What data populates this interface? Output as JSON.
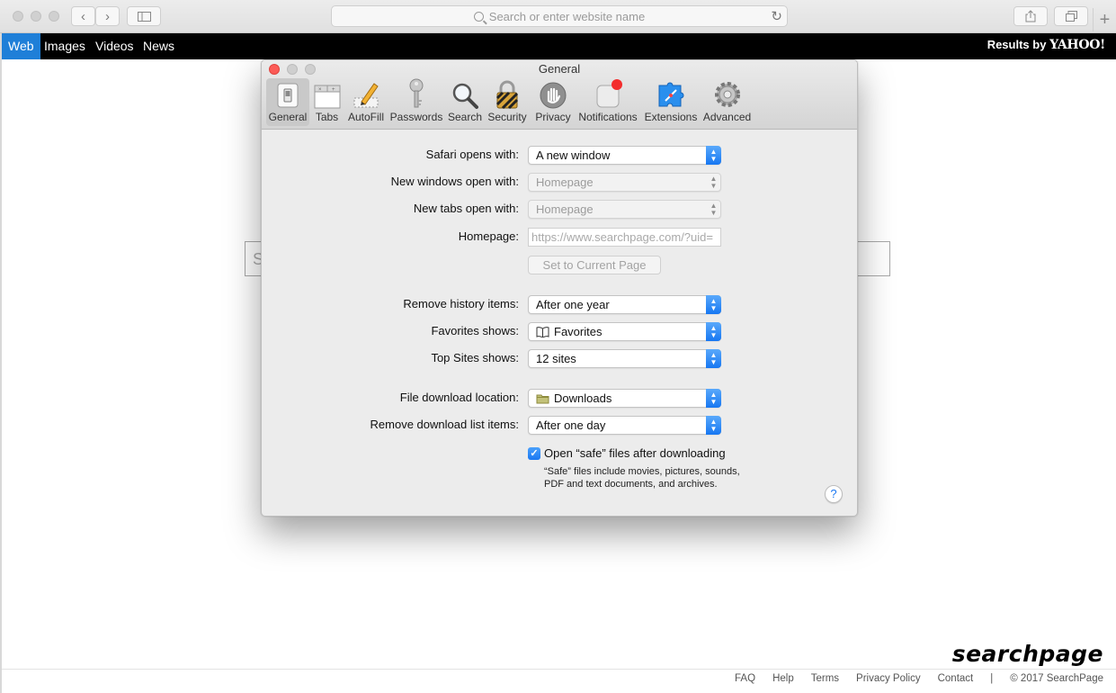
{
  "browser": {
    "address_placeholder": "Search or enter website name"
  },
  "navbar": {
    "items": [
      "Web",
      "Images",
      "Videos",
      "News"
    ],
    "results_prefix": "Results by",
    "results_brand": "YAHOO!"
  },
  "search_bg": {
    "letter": "S"
  },
  "prefs": {
    "title": "General",
    "tabs": [
      {
        "label": "General",
        "icon": "switch-icon"
      },
      {
        "label": "Tabs",
        "icon": "tabs-icon"
      },
      {
        "label": "AutoFill",
        "icon": "pencil-icon"
      },
      {
        "label": "Passwords",
        "icon": "key-icon"
      },
      {
        "label": "Search",
        "icon": "magnifier-icon"
      },
      {
        "label": "Security",
        "icon": "lock-icon"
      },
      {
        "label": "Privacy",
        "icon": "hand-icon"
      },
      {
        "label": "Notifications",
        "icon": "notifications-icon"
      },
      {
        "label": "Extensions",
        "icon": "puzzle-icon"
      },
      {
        "label": "Advanced",
        "icon": "gear-icon"
      }
    ],
    "selected_tab": "General",
    "rows": {
      "safari_opens_label": "Safari opens with:",
      "safari_opens_value": "A new window",
      "new_windows_label": "New windows open with:",
      "new_windows_value": "Homepage",
      "new_tabs_label": "New tabs open with:",
      "new_tabs_value": "Homepage",
      "homepage_label": "Homepage:",
      "homepage_value": "https://www.searchpage.com/?uid=",
      "set_current_label": "Set to Current Page",
      "remove_history_label": "Remove history items:",
      "remove_history_value": "After one year",
      "favorites_label": "Favorites shows:",
      "favorites_value": "Favorites",
      "top_sites_label": "Top Sites shows:",
      "top_sites_value": "12 sites",
      "download_location_label": "File download location:",
      "download_location_value": "Downloads",
      "remove_download_label": "Remove download list items:",
      "remove_download_value": "After one day",
      "open_safe_label": "Open “safe” files after downloading",
      "open_safe_checked": true,
      "safe_note": "“Safe” files include movies, pictures, sounds, PDF and text documents, and archives."
    },
    "help_glyph": "?"
  },
  "page": {
    "logo": "searchpage",
    "footer_links": [
      "FAQ",
      "Help",
      "Terms",
      "Privacy Policy",
      "Contact",
      "|",
      "© 2017 SearchPage"
    ]
  },
  "colors": {
    "nav_active": "#1f7fd8",
    "popup_accent": "#1677f2",
    "close_red": "#fc5b57",
    "notification_badge": "#f32d2d"
  }
}
